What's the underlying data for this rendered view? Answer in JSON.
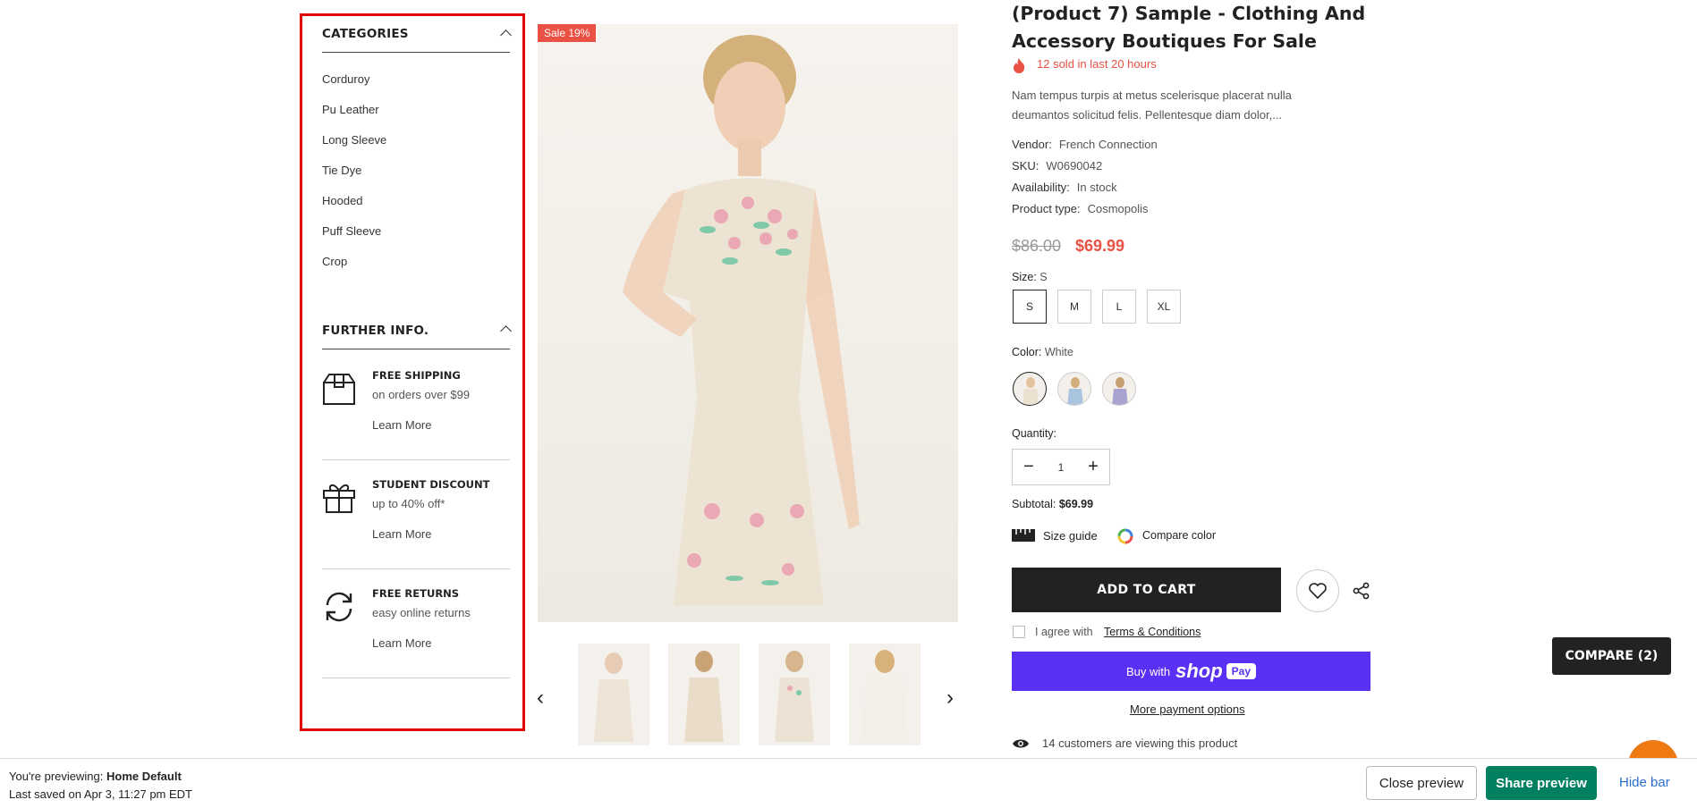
{
  "categories": {
    "heading": "CATEGORIES",
    "items": [
      "Corduroy",
      "Pu Leather",
      "Long Sleeve",
      "Tie Dye",
      "Hooded",
      "Puff Sleeve",
      "Crop"
    ]
  },
  "further_info": {
    "heading": "FURTHER INFO.",
    "blocks": [
      {
        "title": "FREE SHIPPING",
        "subtitle": "on orders over $99",
        "link": "Learn More",
        "icon": "box-icon"
      },
      {
        "title": "STUDENT DISCOUNT",
        "subtitle": "up to 40% off*",
        "link": "Learn More",
        "icon": "gift-icon"
      },
      {
        "title": "FREE RETURNS",
        "subtitle": "easy online returns",
        "link": "Learn More",
        "icon": "refresh-icon"
      }
    ]
  },
  "gallery": {
    "sale_badge": "Sale 19%",
    "thumbnail_count": 4
  },
  "product": {
    "title": "(Product 7) Sample - Clothing And Accessory Boutiques For Sale",
    "sold_text": "12 sold in last 20 hours",
    "description": "Nam tempus turpis at metus scelerisque placerat nulla deumantos solicitud felis. Pellentesque diam dolor,...",
    "vendor_label": "Vendor:",
    "vendor": "French Connection",
    "sku_label": "SKU:",
    "sku": "W0690042",
    "availability_label": "Availability:",
    "availability": "In stock",
    "type_label": "Product type:",
    "type": "Cosmopolis",
    "price_old": "$86.00",
    "price_new": "$69.99",
    "size_label": "Size:",
    "size_value": "S",
    "sizes": [
      "S",
      "M",
      "L",
      "XL"
    ],
    "color_label": "Color:",
    "color_value": "White",
    "quantity_label": "Quantity:",
    "quantity": "1",
    "subtotal_label": "Subtotal:",
    "subtotal": "$69.99",
    "size_guide": "Size guide",
    "compare_color": "Compare color",
    "add_to_cart": "ADD TO CART",
    "agree_text": "I agree with",
    "terms": "Terms & Conditions",
    "buy_with": "Buy with",
    "shop_word": "shop",
    "pay_word": "Pay",
    "more_payment": "More payment options",
    "viewing": "14 customers are viewing this product"
  },
  "compare_float": "COMPARE (2)",
  "preview_bar": {
    "previewing_prefix": "You're previewing:",
    "theme_name": "Home Default",
    "last_saved": "Last saved on Apr 3, 11:27 pm EDT",
    "close_preview": "Close preview",
    "share_preview": "Share preview",
    "hide_bar": "Hide bar"
  },
  "colors": {
    "accent_red": "#e95144",
    "shop_pay_purple": "#5a31f4",
    "share_green": "#008060",
    "highlight_frame": "#e10000"
  }
}
